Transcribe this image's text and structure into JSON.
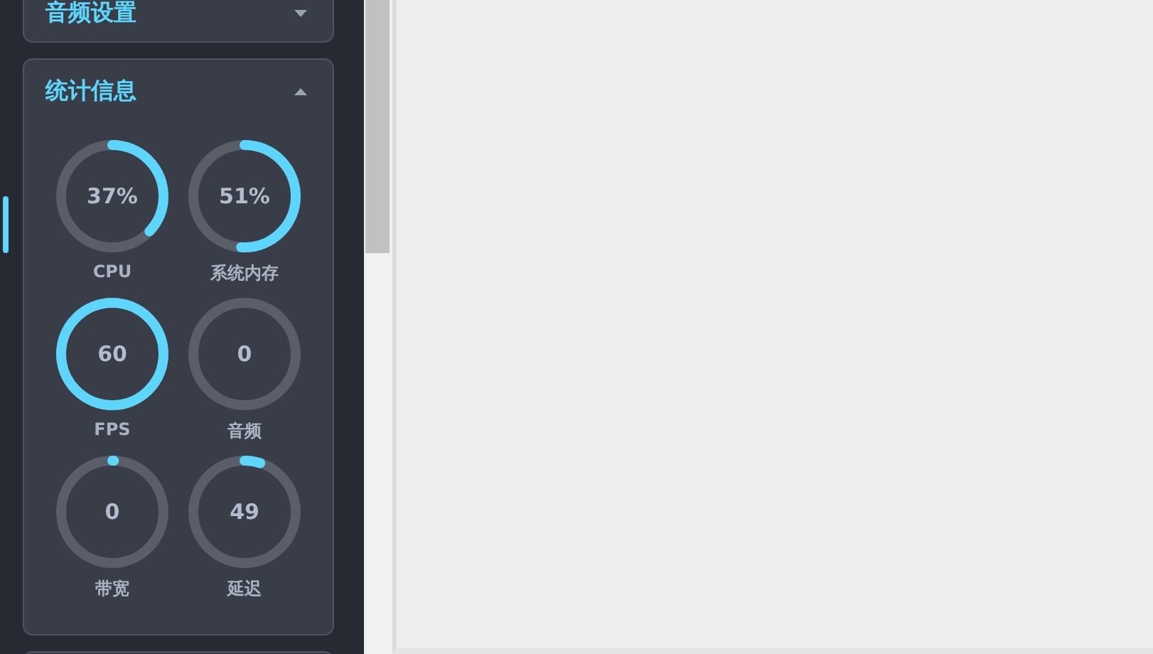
{
  "sidebar": {
    "panels": [
      {
        "title": "音频设置",
        "expanded": false
      },
      {
        "title": "统计信息",
        "expanded": true,
        "gauges": [
          {
            "label": "CPU",
            "value": "37%"
          },
          {
            "label": "系统内存",
            "value": "51%"
          },
          {
            "label": "FPS",
            "value": "60"
          },
          {
            "label": "音频",
            "value": "0"
          },
          {
            "label": "带宽",
            "value": "0"
          },
          {
            "label": "延迟",
            "value": "49"
          }
        ]
      }
    ]
  }
}
